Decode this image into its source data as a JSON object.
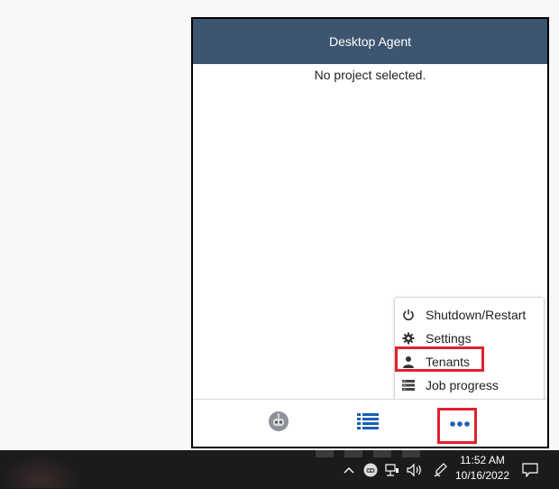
{
  "window": {
    "title": "Desktop Agent",
    "empty_message": "No project selected."
  },
  "menu": {
    "items": [
      {
        "label": "Shutdown/Restart",
        "icon": "power-icon"
      },
      {
        "label": "Settings",
        "icon": "gear-icon"
      },
      {
        "label": "Tenants",
        "icon": "person-icon"
      },
      {
        "label": "Job progress",
        "icon": "server-icon"
      }
    ]
  },
  "footer": {
    "buttons": [
      {
        "name": "robot",
        "icon": "robot-icon"
      },
      {
        "name": "list",
        "icon": "list-icon"
      },
      {
        "name": "more",
        "icon": "more-icon"
      }
    ]
  },
  "taskbar": {
    "time": "11:52 AM",
    "date": "10/16/2022"
  },
  "colors": {
    "header_bg": "#3e5570",
    "accent_blue": "#1b5fb2",
    "highlight_red": "#e0212e",
    "taskbar_bg": "#1b1b1b"
  }
}
